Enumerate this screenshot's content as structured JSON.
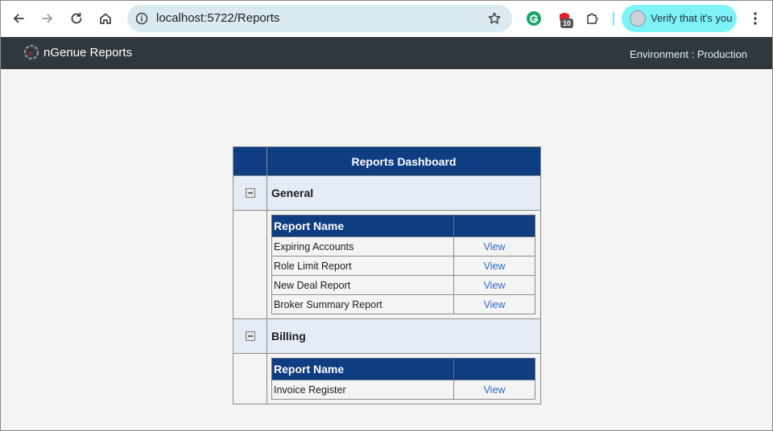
{
  "browser": {
    "url": "localhost:5722/Reports",
    "extension_badge": "10",
    "verify_label": "Verify that it's you"
  },
  "app": {
    "title": "nGenue Reports",
    "environment": "Environment : Production"
  },
  "dashboard": {
    "title": "Reports Dashboard",
    "groups": [
      {
        "name": "General",
        "column_header": "Report Name",
        "reports": [
          {
            "name": "Expiring Accounts",
            "action": "View"
          },
          {
            "name": "Role Limit Report",
            "action": "View"
          },
          {
            "name": "New Deal Report",
            "action": "View"
          },
          {
            "name": "Broker Summary Report",
            "action": "View"
          }
        ]
      },
      {
        "name": "Billing",
        "column_header": "Report Name",
        "reports": [
          {
            "name": "Invoice Register",
            "action": "View"
          }
        ]
      }
    ]
  },
  "colors": {
    "header_bar": "#31373e",
    "table_header": "#0f3d82",
    "group_row": "#e5ecf6",
    "link": "#2f6bc4",
    "verify_pill": "#7df3f7"
  }
}
